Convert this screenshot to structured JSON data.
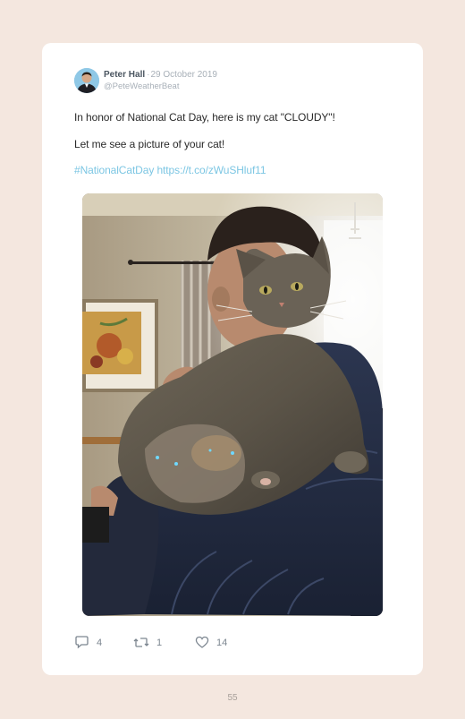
{
  "tweet": {
    "author_name": "Peter Hall",
    "separator": "·",
    "date": "29 October 2019",
    "handle": "@PeteWeatherBeat",
    "text_line1": "In honor of National Cat Day, here is my cat \"CLOUDY\"!",
    "text_line2": "Let me see a picture of your cat!",
    "hashtag": "#NationalCatDay",
    "link": "https://t.co/zWuSHluf11"
  },
  "actions": {
    "replies": "4",
    "retweets": "1",
    "likes": "14"
  },
  "page_number": "55",
  "colors": {
    "background": "#f4e7df",
    "card": "#ffffff",
    "link": "#7cc6e3",
    "muted": "#a8b0b8"
  }
}
